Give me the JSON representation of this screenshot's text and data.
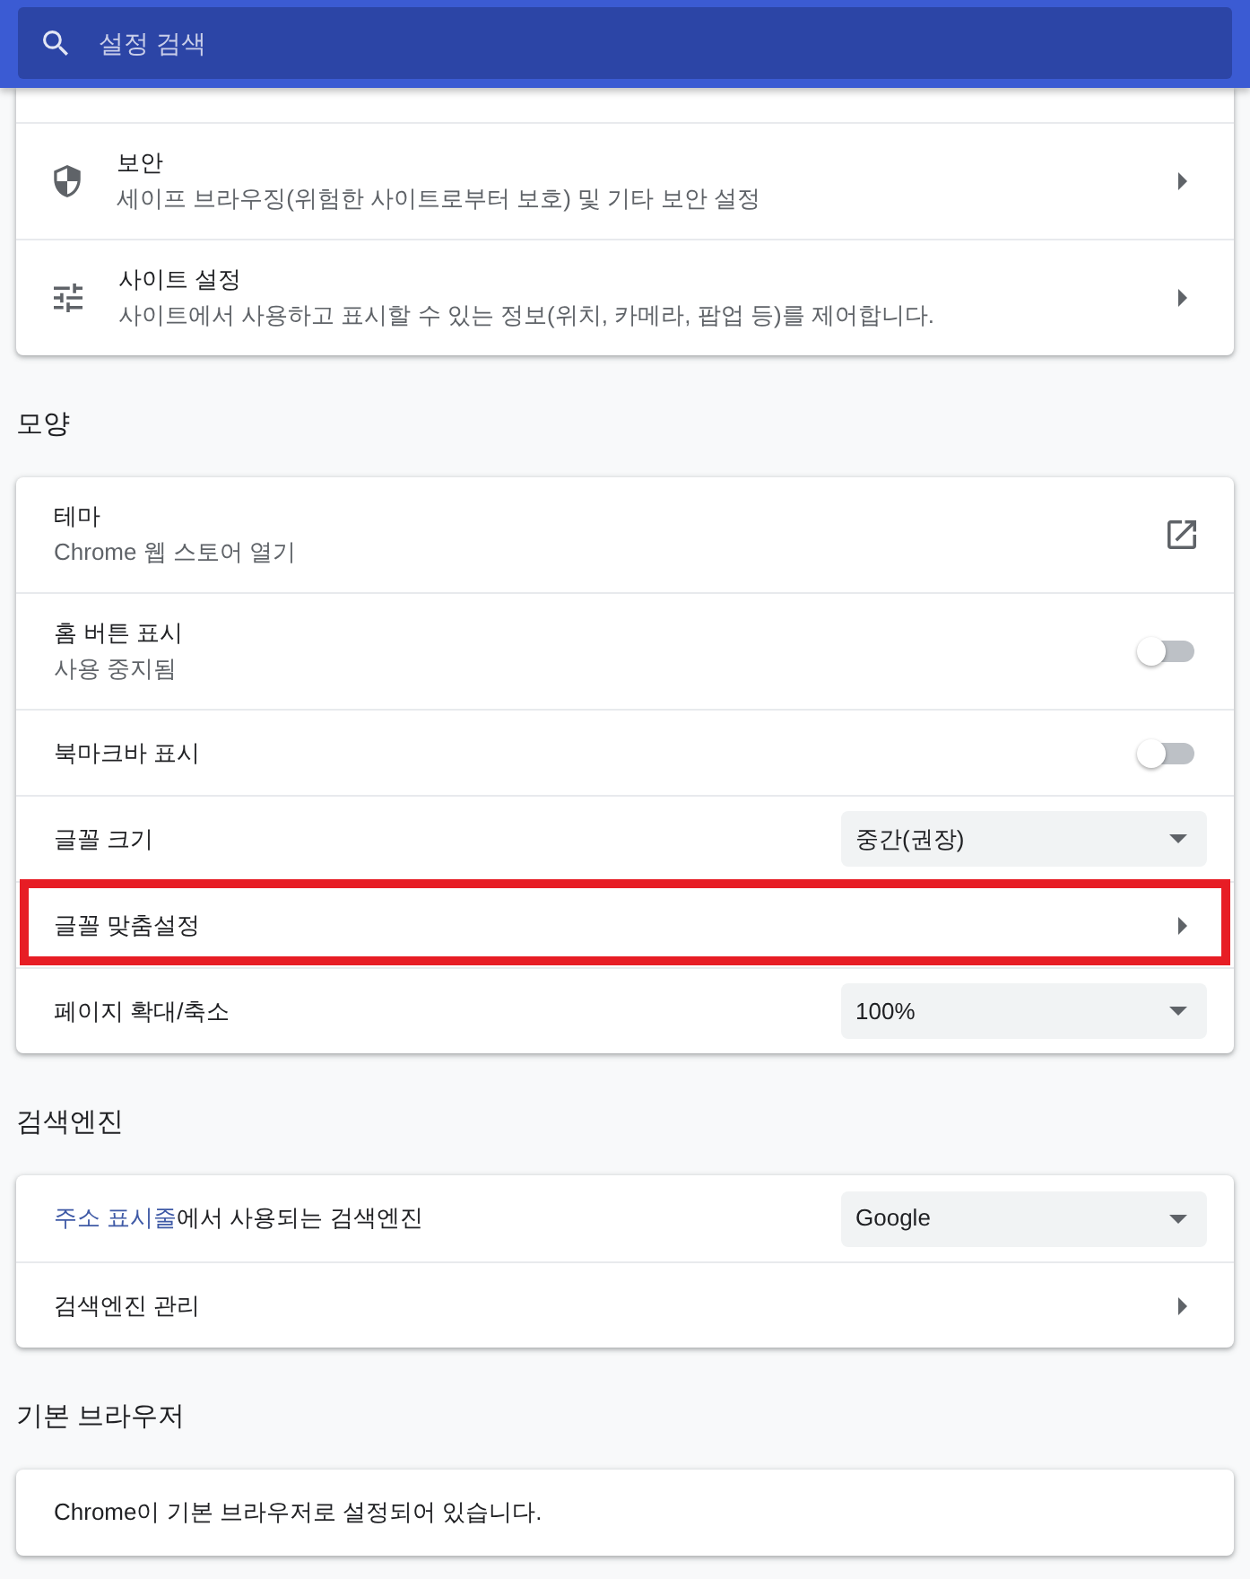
{
  "search": {
    "placeholder": "설정 검색"
  },
  "sections": [
    {
      "rows": [
        {
          "kind": "arrow",
          "title": "보안",
          "subtitle": "세이프 브라우징(위험한 사이트로부터 보호) 및 기타 보안 설정"
        },
        {
          "kind": "arrow",
          "title": "사이트 설정",
          "subtitle": "사이트에서 사용하고 표시할 수 있는 정보(위치, 카메라, 팝업 등)를 제어합니다."
        }
      ]
    },
    {
      "heading": "모양",
      "rows": [
        {
          "kind": "external",
          "title": "테마",
          "subtitle": "Chrome 웹 스토어 열기"
        },
        {
          "kind": "toggle",
          "title": "홈 버튼 표시",
          "subtitle": "사용 중지됨",
          "on": false
        },
        {
          "kind": "toggle",
          "title": "북마크바 표시",
          "on": false
        },
        {
          "kind": "select",
          "title": "글꼴 크기",
          "value": "중간(권장)"
        },
        {
          "kind": "arrow",
          "title": "글꼴 맞춤설정",
          "highlighted": true
        },
        {
          "kind": "select",
          "title": "페이지 확대/축소",
          "value": "100%"
        }
      ]
    },
    {
      "heading": "검색엔진",
      "rows": [
        {
          "kind": "select",
          "link": "주소 표시줄",
          "title": "에서 사용되는 검색엔진",
          "value": "Google"
        },
        {
          "kind": "arrow",
          "title": "검색엔진 관리"
        }
      ]
    },
    {
      "heading": "기본 브라우저",
      "rows": [
        {
          "kind": "text",
          "title": "Chrome이 기본 브라우저로 설정되어 있습니다."
        }
      ]
    }
  ]
}
